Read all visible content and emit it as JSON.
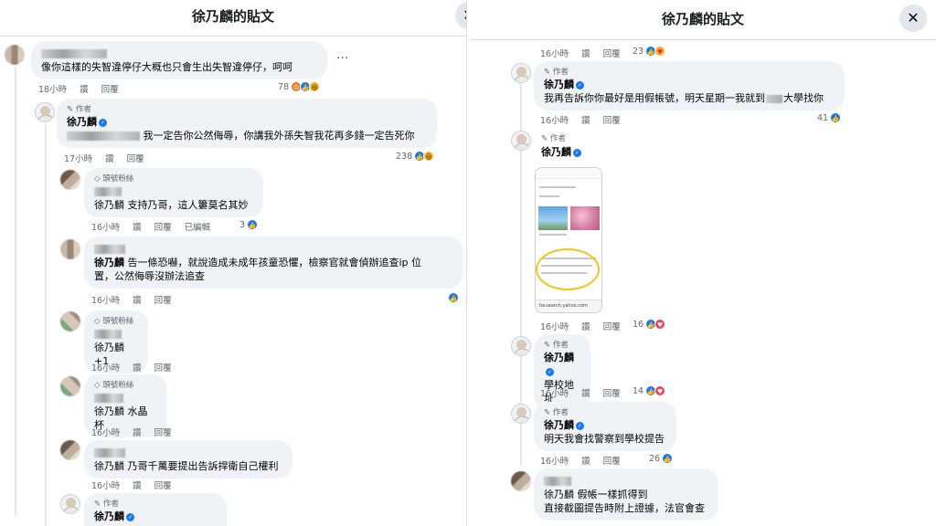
{
  "left": {
    "title": "徐乃麟的貼文",
    "close_icon": "close-icon",
    "comments": {
      "c1": {
        "text": "像你這樣的失智違停仔大概也只會生出失智違停仔，呵呵",
        "time": "18小時",
        "like": "讚",
        "reply": "回覆",
        "count": "78"
      },
      "c2": {
        "badge": "作者",
        "name": "徐乃麟",
        "text": "我一定告你公然侮辱，你講我外孫失智我花再多錢一定告死你",
        "time": "17小時",
        "like": "讚",
        "reply": "回覆",
        "count": "238"
      },
      "c3": {
        "badge": "頭號粉絲",
        "text": "徐乃麟 支持乃哥，這人簍莫名其妙",
        "time": "16小時",
        "like": "讚",
        "reply": "回覆",
        "edited": "已編輯",
        "count": "3"
      },
      "c4": {
        "text1": "告一條恐嚇，就說造成未成年孩童恐懼，檢察官就會偵辦追查ip 位",
        "text2": "置，公然侮辱沒辦法追查",
        "prefix": "徐乃麟",
        "time": "16小時",
        "like": "讚",
        "reply": "回覆"
      },
      "c5": {
        "badge": "頭號粉絲",
        "text": "徐乃麟 +1",
        "time": "16小時",
        "like": "讚",
        "reply": "回覆"
      },
      "c6": {
        "badge": "頭號粉絲",
        "text": "徐乃麟 水晶杯",
        "time": "16小時",
        "like": "讚",
        "reply": "回覆"
      },
      "c7": {
        "text": "徐乃麟 乃哥千萬要提出告訴捍衛自己權利",
        "time": "16小時",
        "like": "讚",
        "reply": "回覆"
      },
      "c8": {
        "badge": "作者",
        "name": "徐乃麟"
      }
    }
  },
  "right": {
    "title": "徐乃麟的貼文",
    "close_icon": "close-icon",
    "comments": {
      "r0": {
        "time": "16小時",
        "like": "讚",
        "reply": "回覆",
        "count": "23"
      },
      "r1": {
        "badge": "作者",
        "name": "徐乃麟",
        "text1": "我再告訴你你最好是用假帳號，明天星期一我就到",
        "text2": "大學找你",
        "time": "16小時",
        "like": "讚",
        "reply": "回覆",
        "count": "41"
      },
      "r2": {
        "badge": "作者",
        "name": "徐乃麟",
        "time": "16小時",
        "like": "讚",
        "reply": "回覆",
        "count": "16",
        "screenshot_footer": "tw.search.yahoo.com"
      },
      "r3": {
        "badge": "作者",
        "name": "徐乃麟",
        "text": "學校地址",
        "time": "16小時",
        "like": "讚",
        "reply": "回覆",
        "count": "14"
      },
      "r4": {
        "badge": "作者",
        "name": "徐乃麟",
        "text": "明天我會找警察到學校提告",
        "time": "16小時",
        "like": "讚",
        "reply": "回覆",
        "count": "26"
      },
      "r5": {
        "text1": "徐乃麟 假帳一樣抓得到",
        "text2": "直接截圖提告時附上證據，法官會查"
      }
    }
  },
  "colors": {
    "like": "#1877f2",
    "bubble": "#f0f2f5",
    "meta": "#65676b"
  }
}
